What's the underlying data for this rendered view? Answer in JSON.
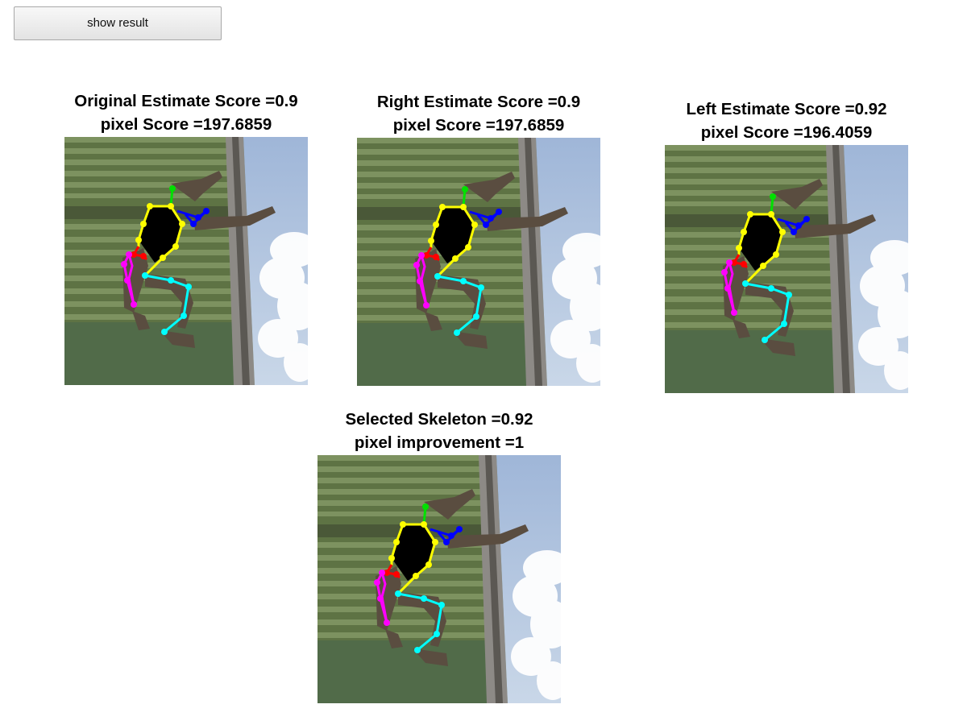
{
  "toolbar": {
    "show_result_label": "show result"
  },
  "panels": {
    "original": {
      "line1": "Original Estimate Score =0.9",
      "line2": "pixel Score =197.6859"
    },
    "right": {
      "line1": "Right Estimate Score =0.9",
      "line2": "pixel Score =197.6859"
    },
    "left": {
      "line1": "Left Estimate Score =0.92",
      "line2": "pixel Score =196.4059"
    },
    "selected": {
      "line1": "Selected Skeleton =0.92",
      "line2": "pixel improvement =1"
    }
  },
  "skeleton_colors": {
    "head": "#00e000",
    "torso": "#ffff00",
    "left_arm": "#0000ff",
    "right_arm": "#ff0000",
    "left_leg": "#00ffff",
    "right_leg": "#ff00ff"
  }
}
